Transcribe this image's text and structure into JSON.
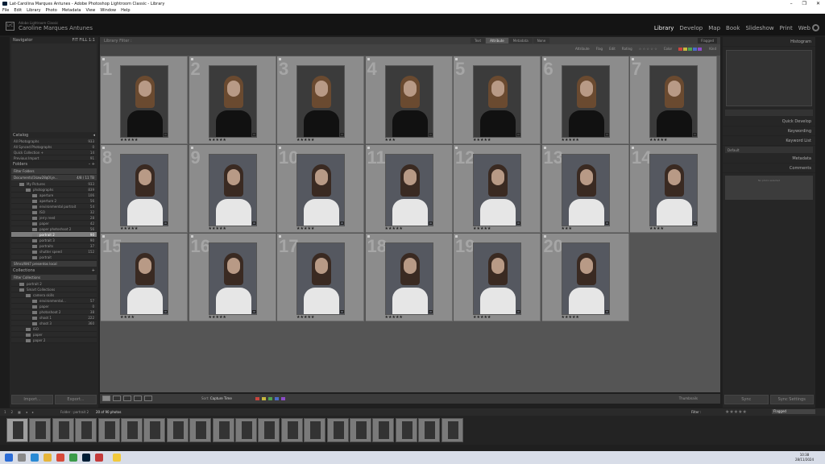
{
  "window": {
    "title": "Lat-Carolina Marques Antunes - Adobe Photoshop Lightroom Classic - Library",
    "controls": [
      "–",
      "❐",
      "✕"
    ]
  },
  "menu": [
    "File",
    "Edit",
    "Library",
    "Photo",
    "Metadata",
    "View",
    "Window",
    "Help"
  ],
  "identity": {
    "logo": "LrC",
    "app": "Adobe Lightroom Classic",
    "user": "Caroline Marques Antunes"
  },
  "modules": [
    {
      "label": "Library",
      "active": true
    },
    {
      "label": "Develop"
    },
    {
      "label": "Map"
    },
    {
      "label": "Book"
    },
    {
      "label": "Slideshow"
    },
    {
      "label": "Print"
    },
    {
      "label": "Web"
    }
  ],
  "left": {
    "navigator": "Navigator",
    "catalog": {
      "title": "Catalog",
      "items": [
        {
          "label": "All Photographs",
          "count": "933"
        },
        {
          "label": "All Synced Photographs",
          "count": "0"
        },
        {
          "label": "Quick Collection +",
          "count": "14"
        },
        {
          "label": "Previous Import",
          "count": "91"
        }
      ]
    },
    "folders": {
      "title": "Folders",
      "filter": "Filter Folders",
      "volume": "Documents/1kaw28q0l.je...",
      "volume_stats": "4/8 / 11 TB",
      "items": [
        {
          "label": "My Pictures",
          "count": "933",
          "level": 1
        },
        {
          "label": "photographs",
          "count": "839",
          "level": 2
        },
        {
          "label": "aperture",
          "count": "106",
          "level": 3
        },
        {
          "label": "aperture 2",
          "count": "56",
          "level": 3
        },
        {
          "label": "environmental portrait",
          "count": "54",
          "level": 3
        },
        {
          "label": "ISO",
          "count": "32",
          "level": 3
        },
        {
          "label": "jerry reed",
          "count": "28",
          "level": 3
        },
        {
          "label": "paper",
          "count": "42",
          "level": 3
        },
        {
          "label": "paper photoshoot 2",
          "count": "56",
          "level": 3
        },
        {
          "label": "portrait 2",
          "count": "90",
          "level": 3,
          "selected": true
        },
        {
          "label": "portrait 3",
          "count": "90",
          "level": 3
        },
        {
          "label": "portraits",
          "count": "37",
          "level": 3
        },
        {
          "label": "shutter speed",
          "count": "152",
          "level": 3
        },
        {
          "label": "portrait",
          "count": "",
          "level": 3
        }
      ],
      "footer": "Sfmrz/Wd7 presentos local"
    },
    "collections": {
      "title": "Collections",
      "filter": "Filter Collections",
      "items": [
        {
          "label": "portrait 2",
          "count": "",
          "level": 1
        },
        {
          "label": "Smart Collections",
          "count": "",
          "level": 1
        },
        {
          "label": "camera skills",
          "count": "",
          "level": 2
        },
        {
          "label": "environmental...",
          "count": "57",
          "level": 3
        },
        {
          "label": "paper",
          "count": "0",
          "level": 3
        },
        {
          "label": "photoshoot 2",
          "count": "38",
          "level": 3
        },
        {
          "label": "shoot 1",
          "count": "222",
          "level": 3
        },
        {
          "label": "shoot 3",
          "count": "360",
          "level": 3
        },
        {
          "label": "ISO",
          "count": "",
          "level": 2
        },
        {
          "label": "paper",
          "count": "",
          "level": 2
        },
        {
          "label": "paper 2",
          "count": "",
          "level": 2
        }
      ]
    },
    "import_btn": "Import...",
    "export_btn": "Export..."
  },
  "filter": {
    "label": "Library Filter :",
    "tabs": [
      "Text",
      "Attribute",
      "Metadata",
      "None"
    ],
    "active_tab": "Attribute",
    "preset": "Flagged"
  },
  "attribute": {
    "label": "Attribute",
    "flag": "Flag",
    "edit": "Edit",
    "rating": "Rating",
    "color": "Color",
    "kind": "Kind"
  },
  "grid": [
    {
      "n": "1",
      "stars": "★★★★★",
      "tone": "dark"
    },
    {
      "n": "2",
      "stars": "★★★★★",
      "tone": "dark"
    },
    {
      "n": "3",
      "stars": "★★★★★",
      "tone": "dark"
    },
    {
      "n": "4",
      "stars": "★★★",
      "tone": "dark"
    },
    {
      "n": "5",
      "stars": "★★★★★",
      "tone": "dark"
    },
    {
      "n": "6",
      "stars": "★★★★★",
      "tone": "dark"
    },
    {
      "n": "7",
      "stars": "★★★★★",
      "tone": "dark"
    },
    {
      "n": "8",
      "stars": "★★★★★",
      "tone": "white"
    },
    {
      "n": "9",
      "stars": "★★★★★",
      "tone": "white"
    },
    {
      "n": "10",
      "stars": "★★★★★",
      "tone": "white"
    },
    {
      "n": "11",
      "stars": "★★★★★",
      "tone": "white"
    },
    {
      "n": "12",
      "stars": "★★★★★",
      "tone": "white"
    },
    {
      "n": "13",
      "stars": "★★★",
      "tone": "white"
    },
    {
      "n": "14",
      "stars": "★★★★",
      "tone": "white"
    },
    {
      "n": "15",
      "stars": "★★★★",
      "tone": "white"
    },
    {
      "n": "16",
      "stars": "★★★★★",
      "tone": "white"
    },
    {
      "n": "17",
      "stars": "★★★★★",
      "tone": "white"
    },
    {
      "n": "18",
      "stars": "★★★★★",
      "tone": "white"
    },
    {
      "n": "19",
      "stars": "★★★★★",
      "tone": "white"
    },
    {
      "n": "20",
      "stars": "★★★★★",
      "tone": "white"
    }
  ],
  "toolbar": {
    "sort_label": "Sort:",
    "sort_value": "Capture Time",
    "thumbnails": "Thumbnails"
  },
  "right": {
    "histogram": "Histogram",
    "quick_develop": "Quick Develop",
    "keywording": "Keywording",
    "keyword_list": "Keyword List",
    "metadata": "Metadata",
    "metadata_preset": "Default",
    "comments": "Comments",
    "comments_placeholder": "No photo selected",
    "sync_btn": "Sync",
    "sync_settings_btn": "Sync Settings"
  },
  "filmstrip": {
    "sources": [
      "1",
      "2"
    ],
    "path": "Folder : portrait 2",
    "count": "20 of 90 photos",
    "filter_label": "Filter :",
    "filter_stars": "★★★★★",
    "flag_value": "Flagged",
    "thumb_count": 20
  },
  "taskbar": {
    "time": "10:38",
    "date": "28/11/2024"
  },
  "colors": {
    "swatches": [
      "#c8453e",
      "#c8b83e",
      "#4fa34f",
      "#4c6bc8",
      "#8c4cc8"
    ]
  }
}
